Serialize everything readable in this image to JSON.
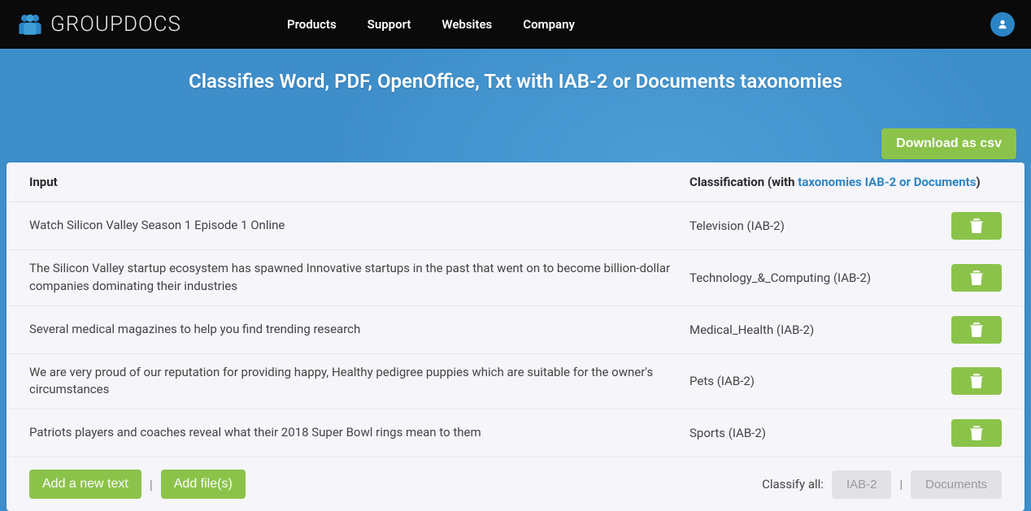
{
  "brand": "GROUPDOCS",
  "nav": {
    "products": "Products",
    "support": "Support",
    "websites": "Websites",
    "company": "Company"
  },
  "hero": {
    "title": "Classifies Word, PDF, OpenOffice, Txt with IAB-2 or Documents taxonomies"
  },
  "download_label": "Download as csv",
  "table": {
    "headers": {
      "input": "Input",
      "classification_prefix": "Classification (with ",
      "classification_link": "taxonomies IAB-2 or Documents",
      "classification_suffix": ")"
    },
    "rows": [
      {
        "input": "Watch Silicon Valley Season 1 Episode 1 Online",
        "classification": "Television (IAB-2)"
      },
      {
        "input": "The Silicon Valley startup ecosystem has spawned Innovative startups in the past that went on to become billion-dollar companies dominating their industries",
        "classification": "Technology_&_Computing (IAB-2)"
      },
      {
        "input": "Several medical magazines to help you find trending research",
        "classification": "Medical_Health (IAB-2)"
      },
      {
        "input": "We are very proud of our reputation for providing happy, Healthy pedigree puppies which are suitable for the owner's circumstances",
        "classification": "Pets (IAB-2)"
      },
      {
        "input": "Patriots players and coaches reveal what their 2018 Super Bowl rings mean to them",
        "classification": "Sports (IAB-2)"
      }
    ]
  },
  "footer": {
    "add_text": "Add a new text",
    "add_files": "Add file(s)",
    "classify_all_label": "Classify all:",
    "btn_iab2": "IAB-2",
    "btn_documents": "Documents",
    "separator": "|"
  },
  "icons": {
    "trash": "trash-icon",
    "user": "user-icon",
    "logo": "groupdocs-logo-icon"
  }
}
